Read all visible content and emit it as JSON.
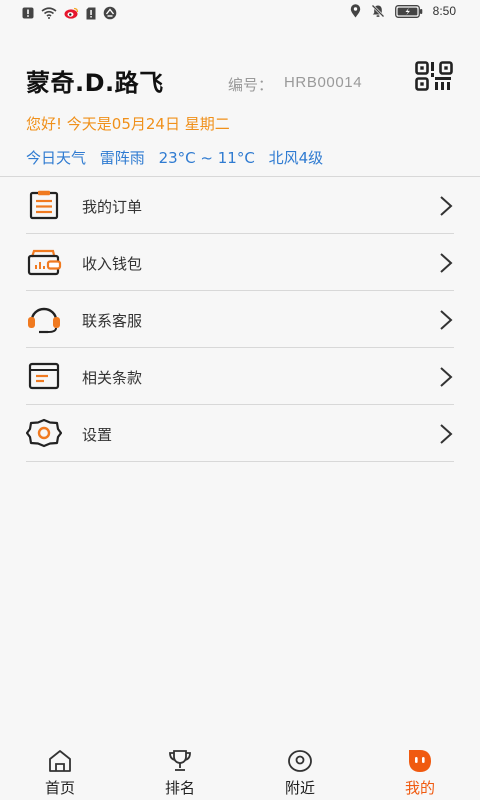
{
  "status_bar": {
    "time": "8:50",
    "left_icons": [
      "alert-icon",
      "wifi-icon",
      "weibo-icon",
      "sim-alert-icon",
      "sync-icon"
    ],
    "right_icons": [
      "location-icon",
      "mute-icon",
      "battery-icon"
    ]
  },
  "user": {
    "name": "蒙奇.D.路飞",
    "id_label": "编号：",
    "id_value": "HRB00014",
    "greeting": "您好!  今天是05月24日 星期二",
    "weather_title": "今日天气",
    "weather_condition": "雷阵雨",
    "weather_temp": "23°C ~ 11°C",
    "weather_wind": "北风4级"
  },
  "menu": {
    "items": [
      {
        "label": "我的订单",
        "icon": "order-icon"
      },
      {
        "label": "收入钱包",
        "icon": "wallet-icon"
      },
      {
        "label": "联系客服",
        "icon": "headset-icon"
      },
      {
        "label": "相关条款",
        "icon": "terms-icon"
      },
      {
        "label": "设置",
        "icon": "settings-icon"
      }
    ]
  },
  "tabs": [
    {
      "label": "首页",
      "icon": "home-icon",
      "active": false
    },
    {
      "label": "排名",
      "icon": "trophy-icon",
      "active": false
    },
    {
      "label": "附近",
      "icon": "location-pin-icon",
      "active": false
    },
    {
      "label": "我的",
      "icon": "profile-icon",
      "active": true
    }
  ],
  "colors": {
    "accent_orange": "#f0901a",
    "weather_blue": "#2f7bd1",
    "active_tab": "#f05a10",
    "icon_orange": "#f07a20"
  }
}
